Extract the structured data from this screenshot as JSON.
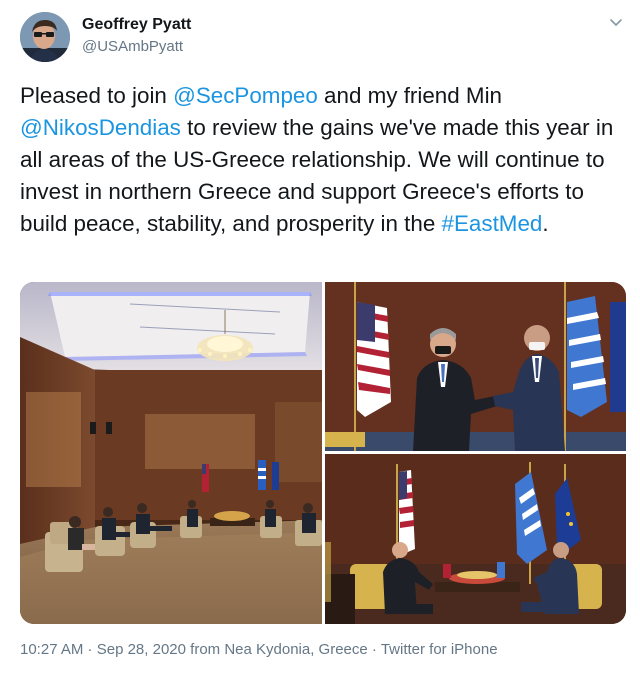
{
  "author": {
    "name": "Geoffrey Pyatt",
    "handle": "@USAmbPyatt"
  },
  "tweet": {
    "t1": "Pleased to join ",
    "m1": "@SecPompeo",
    "t2": " and my friend Min ",
    "m2": "@NikosDendias",
    "t3": " to review the gains we've made this year in all areas of the US-Greece relationship. We will continue to invest in northern Greece and support Greece's efforts to build peace, stability, and prosperity in the ",
    "hashtag": "#EastMed",
    "t4": "."
  },
  "meta": {
    "time": "10:27 AM",
    "sep1": " · ",
    "date": "Sep 28, 2020",
    "from": " from ",
    "location": "Nea Kydonia, Greece",
    "sep2": " · ",
    "source": "Twitter for iPhone"
  },
  "icons": {
    "menu": "chevron-down-icon",
    "avatar": "avatar"
  },
  "colors": {
    "link": "#1b95e0",
    "secondary": "#657786",
    "text": "#14171a"
  }
}
